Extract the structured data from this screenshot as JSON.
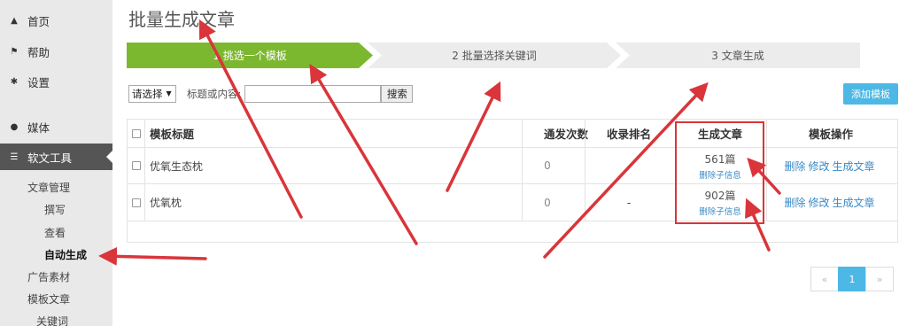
{
  "sidebar": {
    "items": [
      {
        "label": "首页",
        "icon": "home-icon"
      },
      {
        "label": "帮助",
        "icon": "flag-icon"
      },
      {
        "label": "设置",
        "icon": "gear-icon"
      },
      {
        "label": "媒体",
        "icon": "map-pin-icon"
      },
      {
        "label": "软文工具",
        "icon": "list-icon"
      }
    ],
    "sub_items": [
      "文章管理",
      "撰写",
      "查看",
      "自动生成",
      "广告素材",
      "模板文章",
      "关键词"
    ]
  },
  "page_title": "批量生成文章",
  "steps": [
    "1 挑选一个模板",
    "2 批量选择关键词",
    "3 文章生成"
  ],
  "toolbar": {
    "select_value": "请选择",
    "filter_label": "标题或内容:",
    "search_label": "搜索",
    "add_label": "添加模板"
  },
  "table": {
    "headers": [
      "模板标题",
      "通发次数",
      "收录排名",
      "生成文章",
      "模板操作"
    ],
    "rows": [
      {
        "title": "优氧生态枕",
        "count": "0",
        "rank": "",
        "generated": "561篇",
        "generated_sub": "删除子信息",
        "actions": [
          "删除",
          "修改",
          "生成文章"
        ]
      },
      {
        "title": "优氧枕",
        "count": "0",
        "rank": "-",
        "generated": "902篇",
        "generated_sub": "删除子信息",
        "actions": [
          "删除",
          "修改",
          "生成文章"
        ]
      }
    ]
  },
  "pagination": {
    "prev": "«",
    "page": "1",
    "next": "»"
  },
  "colors": {
    "step_active": "#7cb82f",
    "accent_blue": "#4db8e5",
    "annotation_red": "#d9353a",
    "sidebar_active": "#555555"
  }
}
